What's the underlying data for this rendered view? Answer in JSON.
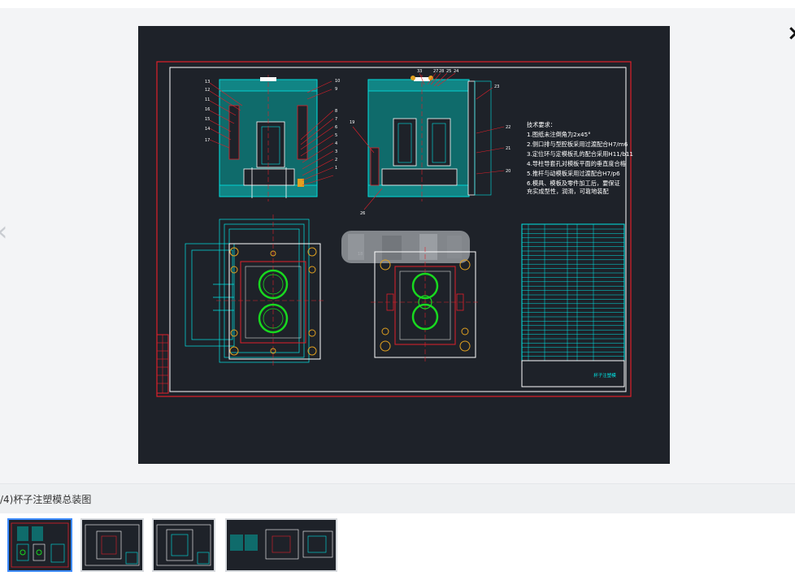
{
  "viewer": {
    "prev_icon": "chevron-left-icon",
    "close_icon": "close-icon",
    "prev_glyph": "‹",
    "close_glyph": "×"
  },
  "drawing": {
    "tech_requirements": [
      "技术要求：",
      "1.图纸未注倒角为2x45°",
      "2.侧口排与型腔板采用过渡配合H7/m6",
      "3.定位环与定模板孔的配合采用H11/b11",
      "4.导柱导套孔对模板平面的垂直度合格",
      "5.推杆与动模板采用过渡配合H7/p6",
      "6.模具、模板及零件加工后，要保证",
      "  充实成型性，润滑，可靠地装配"
    ],
    "callouts_top": [
      "33",
      "27",
      "28",
      "25",
      "24"
    ],
    "callouts_left": [
      "13",
      "12",
      "11",
      "16",
      "15",
      "14",
      "17"
    ],
    "callouts_mid": [
      "10",
      "9",
      "8",
      "7",
      "6",
      "5",
      "4",
      "3",
      "2",
      "1"
    ],
    "callout_right_top": "23",
    "callouts_right": [
      "22",
      "21",
      "20"
    ],
    "callout_19": "19",
    "callout_26": "26",
    "callout_18": "18",
    "title_block": "杯子注塑模"
  },
  "caption": {
    "text": "/4)杯子注塑模总装图"
  },
  "thumbnails": [
    {
      "label": "thumb-1"
    },
    {
      "label": "thumb-2"
    },
    {
      "label": "thumb-3"
    },
    {
      "label": "thumb-4"
    }
  ],
  "colors": {
    "stage_bg": "#1e2229",
    "cad_cyan": "#00e5e5",
    "cad_red": "#e0202a",
    "cad_green": "#18d81f",
    "cad_white": "#ffffff",
    "thumb_active": "#3d8bff"
  }
}
